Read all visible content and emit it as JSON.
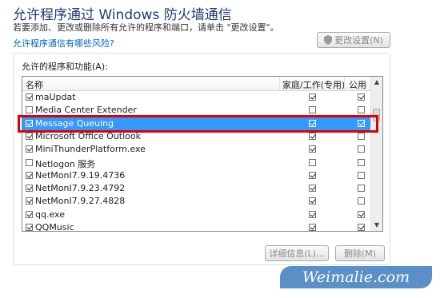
{
  "dialog": {
    "title": "允许程序通过 Windows 防火墙通信",
    "description": "若要添加、更改或删除所有允许的程序和端口，请单击 \"更改设置\"。",
    "risk_link": "允许程序通信有哪些风险?",
    "change_settings_button": "更改设置(N)"
  },
  "list": {
    "group_label": "允许的程序和功能(A):",
    "headers": {
      "name": "名称",
      "home": "家庭/工作(专用)",
      "public": "公用"
    },
    "rows": [
      {
        "name": "maUpdat",
        "enabled": true,
        "home": true,
        "public": true,
        "selected": false
      },
      {
        "name": "Media Center Extender",
        "enabled": false,
        "home": false,
        "public": false,
        "selected": false
      },
      {
        "name": "Message Queuing",
        "enabled": true,
        "home": true,
        "public": true,
        "selected": true
      },
      {
        "name": "Microsoft Office Outlook",
        "enabled": true,
        "home": true,
        "public": false,
        "selected": false
      },
      {
        "name": "MiniThunderPlatform.exe",
        "enabled": true,
        "home": true,
        "public": false,
        "selected": false
      },
      {
        "name": "Netlogon 服务",
        "enabled": false,
        "home": false,
        "public": false,
        "selected": false
      },
      {
        "name": "NetMonI7.9.19.4736",
        "enabled": true,
        "home": true,
        "public": false,
        "selected": false
      },
      {
        "name": "NetMonI7.9.23.4792",
        "enabled": true,
        "home": true,
        "public": false,
        "selected": false
      },
      {
        "name": "NetMonI7.9.27.4828",
        "enabled": true,
        "home": true,
        "public": false,
        "selected": false
      },
      {
        "name": "qq.exe",
        "enabled": true,
        "home": true,
        "public": true,
        "selected": false
      },
      {
        "name": "QQMusic",
        "enabled": true,
        "home": true,
        "public": true,
        "selected": false
      }
    ]
  },
  "buttons": {
    "details": "详细信息(L)...",
    "delete": "删除(M)"
  },
  "watermark": {
    "text": "Weimalie.com"
  },
  "colors": {
    "selection": "#3399ff",
    "highlight_border": "#e00000",
    "title": "#1e3a78",
    "link": "#0066cc"
  }
}
